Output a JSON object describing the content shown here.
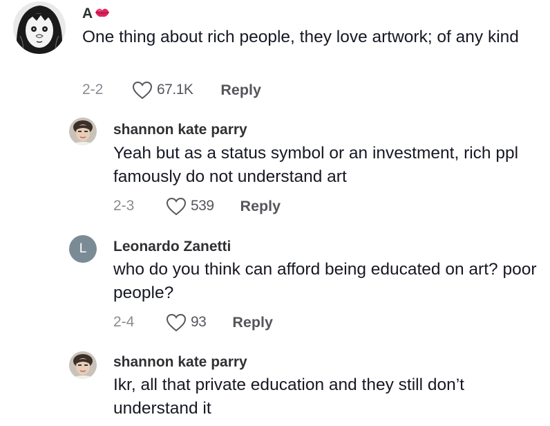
{
  "comments": [
    {
      "username": "A",
      "username_emoji": "lips-emoji",
      "text": "One thing about rich people, they love artwork; of any kind",
      "date": "2-2",
      "likes": "67.1K",
      "reply_label": "Reply",
      "avatar": "manga-portrait-avatar"
    },
    {
      "username": "shannon kate parry",
      "text": "Yeah but as a status symbol or an investment, rich ppl famously do not understand art",
      "date": "2-3",
      "likes": "539",
      "reply_label": "Reply",
      "avatar": "photo-avatar"
    },
    {
      "username": "Leonardo Zanetti",
      "text": "who do you think can afford being educated on art? poor people?",
      "date": "2-4",
      "likes": "93",
      "reply_label": "Reply",
      "avatar": "initial-avatar",
      "avatar_initial": "L",
      "avatar_color": "#7b8b96"
    },
    {
      "username": "shannon kate parry",
      "text": "Ikr, all that private education and they still don’t understand it",
      "avatar": "photo-avatar"
    }
  ],
  "icons": {
    "like": "heart-outline-icon"
  },
  "colors": {
    "text": "#161823",
    "secondary": "#8a8b91",
    "action": "#55565c"
  }
}
